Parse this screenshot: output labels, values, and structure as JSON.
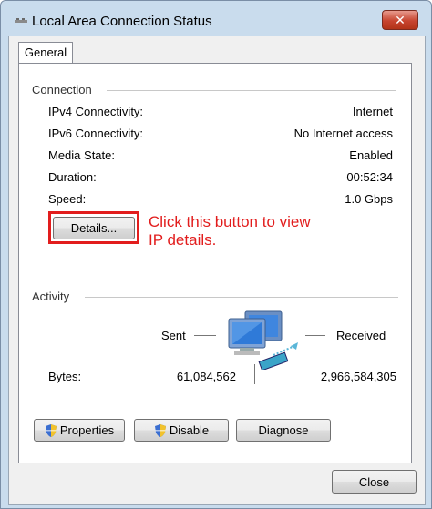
{
  "window": {
    "title": "Local Area Connection Status",
    "close_glyph": "✕"
  },
  "tabs": [
    "General"
  ],
  "connection": {
    "heading": "Connection",
    "rows": [
      {
        "label": "IPv4 Connectivity:",
        "value": "Internet"
      },
      {
        "label": "IPv6 Connectivity:",
        "value": "No Internet access"
      },
      {
        "label": "Media State:",
        "value": "Enabled"
      },
      {
        "label": "Duration:",
        "value": "00:52:34"
      },
      {
        "label": "Speed:",
        "value": "1.0 Gbps"
      }
    ],
    "details_button": "Details..."
  },
  "annotation": {
    "line1": "Click this button to view",
    "line2": "IP details.",
    "color": "#e21d1d"
  },
  "activity": {
    "heading": "Activity",
    "sent_label": "Sent",
    "received_label": "Received",
    "bytes_label": "Bytes:",
    "bytes_sent": "61,084,562",
    "bytes_received": "2,966,584,305",
    "icon": "network-computers-icon"
  },
  "buttons": {
    "properties": "Properties",
    "disable": "Disable",
    "diagnose": "Diagnose",
    "close": "Close"
  }
}
